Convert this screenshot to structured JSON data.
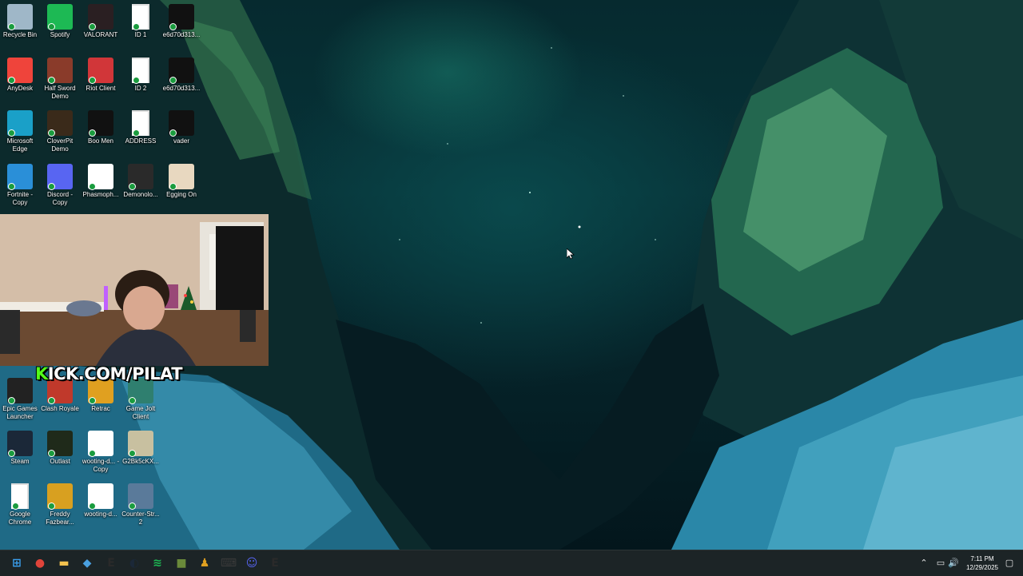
{
  "desktop": {
    "icons_col1": [
      {
        "label": "Recycle Bin",
        "icon": "recycle-bin-icon",
        "color": "#9fb7c8"
      },
      {
        "label": "AnyDesk",
        "icon": "anydesk-icon",
        "color": "#ef443b"
      },
      {
        "label": "Microsoft Edge",
        "icon": "edge-icon",
        "color": "#1aa0c8"
      },
      {
        "label": "Fortnite - Copy",
        "icon": "fortnite-icon",
        "color": "#2a8fd8"
      },
      {
        "label": "Epic Games Launcher",
        "icon": "epic-games-icon",
        "color": "#222222"
      },
      {
        "label": "Steam",
        "icon": "steam-icon",
        "color": "#1b2838"
      },
      {
        "label": "Google Chrome",
        "icon": "document-icon",
        "color": "#ffffff"
      }
    ],
    "icons_col2": [
      {
        "label": "Spotify",
        "icon": "spotify-icon",
        "color": "#1db954"
      },
      {
        "label": "Half Sword Demo",
        "icon": "half-sword-icon",
        "color": "#8a3b2a"
      },
      {
        "label": "CloverPit Demo",
        "icon": "cloverpit-icon",
        "color": "#3a2a1a"
      },
      {
        "label": "Discord - Copy",
        "icon": "discord-icon",
        "color": "#5865f2"
      },
      {
        "label": "Clash Royale",
        "icon": "clash-royale-icon",
        "color": "#c0392b"
      },
      {
        "label": "Outlast",
        "icon": "outlast-icon",
        "color": "#1f2a1a"
      },
      {
        "label": "Freddy Fazbear...",
        "icon": "freddy-icon",
        "color": "#d8a020"
      }
    ],
    "icons_col3": [
      {
        "label": "VALORANT",
        "icon": "valorant-icon",
        "color": "#2a1f22"
      },
      {
        "label": "Riot Client",
        "icon": "riot-client-icon",
        "color": "#d13639"
      },
      {
        "label": "Boo Men",
        "icon": "boo-men-icon",
        "color": "#111111"
      },
      {
        "label": "Phasmoph...",
        "icon": "phasmophobia-icon",
        "color": "#ffffff"
      },
      {
        "label": "Retrac",
        "icon": "retrac-icon",
        "color": "#e0a020"
      },
      {
        "label": "wooting-d... - Copy",
        "icon": "wooting-icon",
        "color": "#ffffff"
      },
      {
        "label": "wooting-d...",
        "icon": "wooting-icon",
        "color": "#ffffff"
      }
    ],
    "icons_col4": [
      {
        "label": "ID 1",
        "icon": "document-icon",
        "color": "#ffffff"
      },
      {
        "label": "ID 2",
        "icon": "document-icon",
        "color": "#ffffff"
      },
      {
        "label": "ADDRESS",
        "icon": "document-icon",
        "color": "#ffffff"
      },
      {
        "label": "Demonolo...",
        "icon": "demonologist-icon",
        "color": "#2a2a2a"
      },
      {
        "label": "Game Jolt Client",
        "icon": "game-jolt-icon",
        "color": "#2f7f6f"
      },
      {
        "label": "G2Bk5cKX...",
        "icon": "image-file-icon",
        "color": "#c8c0a0"
      },
      {
        "label": "Counter-Str... 2",
        "icon": "counter-strike-icon",
        "color": "#5a7a9a"
      }
    ],
    "icons_col5": [
      {
        "label": "e6d70d313...",
        "icon": "image-file-icon",
        "color": "#111111"
      },
      {
        "label": "e6d70d313...",
        "icon": "image-file-icon",
        "color": "#111111"
      },
      {
        "label": "vader",
        "icon": "image-file-icon",
        "color": "#111111"
      },
      {
        "label": "Egging On",
        "icon": "egging-on-icon",
        "color": "#e8d8c0"
      }
    ]
  },
  "stream_overlay": {
    "kick_prefix": "K",
    "kick_rest": "ICK.COM/PILAT"
  },
  "taskbar": {
    "apps": [
      {
        "name": "start-button",
        "icon": "windows-start-icon",
        "glyph": "⊞",
        "color": "#3aa0f0"
      },
      {
        "name": "chrome",
        "icon": "chrome-icon",
        "glyph": "●",
        "color": "#e0443a"
      },
      {
        "name": "file-explorer",
        "icon": "folder-icon",
        "glyph": "▬",
        "color": "#f2c14e"
      },
      {
        "name": "app-blue",
        "icon": "app-icon",
        "glyph": "◆",
        "color": "#4aa0e0"
      },
      {
        "name": "epic-games",
        "icon": "epic-games-icon",
        "glyph": "E",
        "color": "#2a2a2a"
      },
      {
        "name": "steam",
        "icon": "steam-icon",
        "glyph": "◐",
        "color": "#1b2838"
      },
      {
        "name": "spotify",
        "icon": "spotify-icon",
        "glyph": "≋",
        "color": "#1db954"
      },
      {
        "name": "minecraft",
        "icon": "minecraft-icon",
        "glyph": "■",
        "color": "#6a8a3a"
      },
      {
        "name": "retrac",
        "icon": "retrac-icon",
        "glyph": "♟",
        "color": "#e0a020"
      },
      {
        "name": "wooting",
        "icon": "wooting-icon",
        "glyph": "⌨",
        "color": "#3a3a3a"
      },
      {
        "name": "discord",
        "icon": "discord-icon",
        "glyph": "☺",
        "color": "#5865f2"
      },
      {
        "name": "epic-games-2",
        "icon": "epic-games-icon",
        "glyph": "E",
        "color": "#2a2a2a"
      }
    ],
    "tray": {
      "chevron": "⌃",
      "network": "▭",
      "volume": "🔊",
      "notification": "▢"
    },
    "clock": {
      "time": "7:11 PM",
      "date": "12/29/2025"
    }
  }
}
